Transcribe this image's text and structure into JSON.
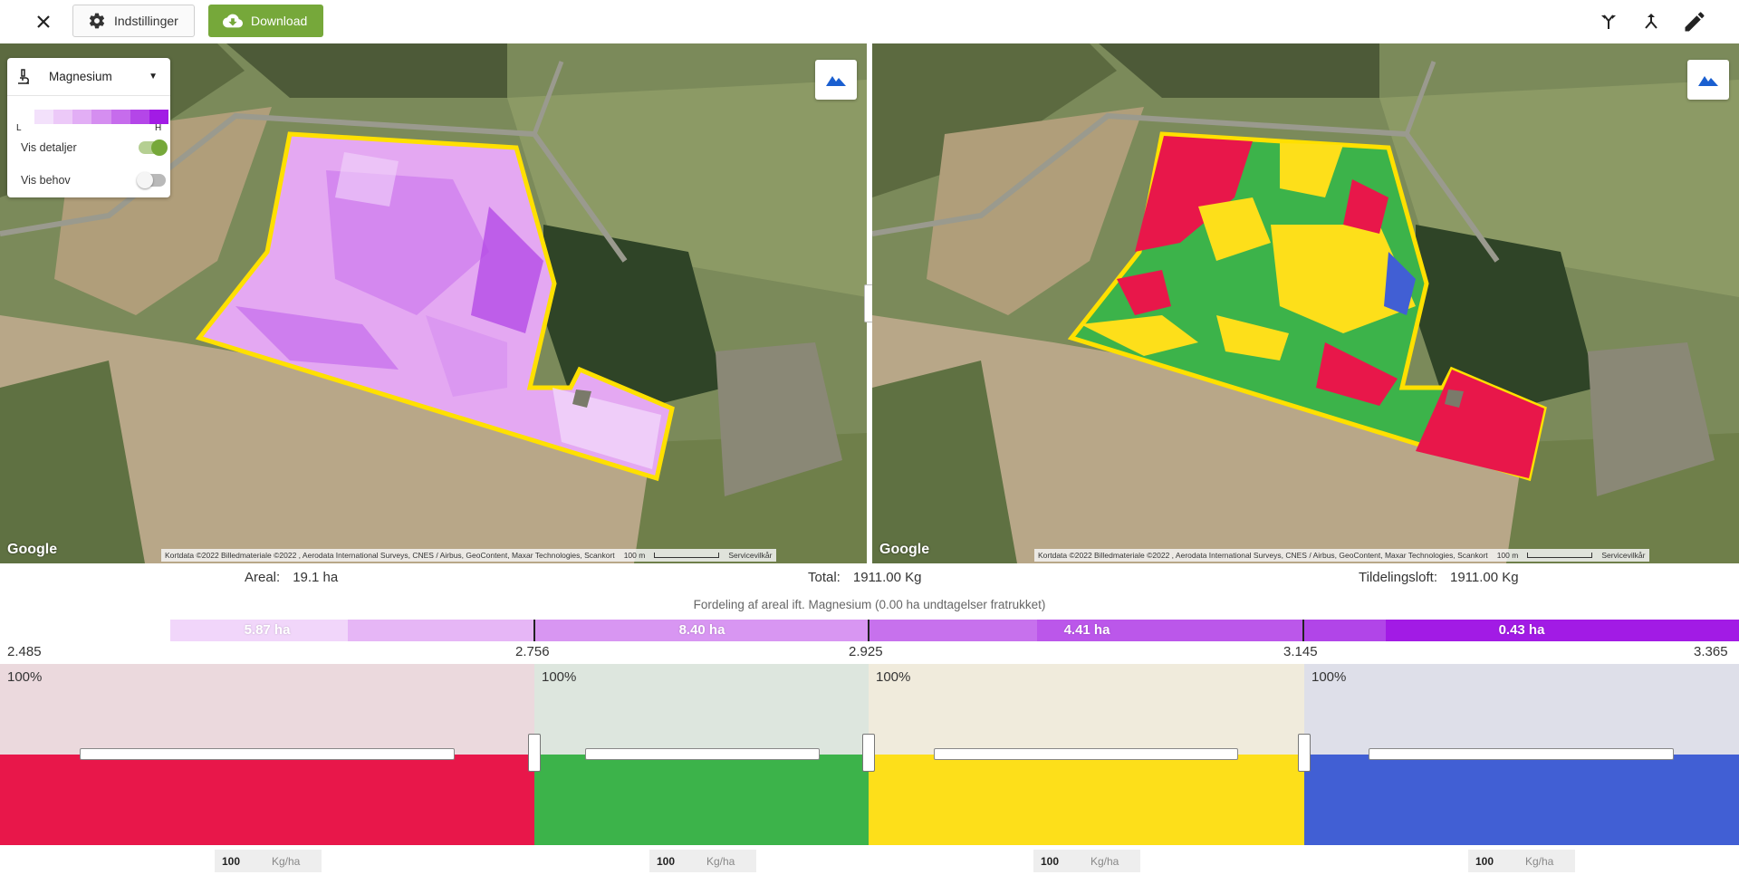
{
  "toolbar": {
    "close_icon": "close-icon",
    "settings_label": "Indstillinger",
    "settings_icon": "gear-icon",
    "download_label": "Download",
    "download_icon": "cloud-download-icon",
    "tools": [
      "split-icon",
      "merge-icon",
      "pencil-icon"
    ]
  },
  "layer_panel": {
    "layer_icon": "microscope-icon",
    "selected_layer": "Magnesium",
    "legend_low": "L",
    "legend_high": "H",
    "legend_colors": [
      "#f3e1fb",
      "#ecc9f8",
      "#e2aef5",
      "#d58ef0",
      "#c66cec",
      "#b446e8",
      "#a21be5"
    ],
    "show_details_label": "Vis detaljer",
    "show_details": true,
    "show_need_label": "Vis behov",
    "show_need": false
  },
  "map": {
    "google": "Google",
    "attribution": "Kortdata ©2022 Billedmateriale ©2022 , Aerodata International Surveys, CNES / Airbus, GeoContent, Maxar Technologies, Scankort",
    "scale": "100 m",
    "terms": "Servicevilkår"
  },
  "stats": {
    "area_label": "Areal:",
    "area_value": "19.1 ha",
    "total_label": "Total:",
    "total_value": "1911.00 Kg",
    "cap_label": "Tildelingsloft:",
    "cap_value": "1911.00 Kg"
  },
  "distribution": {
    "title": "Fordeling af areal ift. Magnesium (0.00 ha undtagelser fratrukket)",
    "zones": [
      {
        "area": "5.87 ha"
      },
      {
        "area": "8.40 ha"
      },
      {
        "area": "4.41 ha"
      },
      {
        "area": "0.43 ha"
      }
    ],
    "ticks": [
      "2.485",
      "2.756",
      "2.925",
      "3.145",
      "3.365"
    ]
  },
  "allocation": {
    "zones": [
      {
        "percent": "100%",
        "color": "#e8174a",
        "tint": "#ebd9dd",
        "rate": "100",
        "unit": "Kg/ha"
      },
      {
        "percent": "100%",
        "color": "#3cb34a",
        "tint": "#dde6de",
        "rate": "100",
        "unit": "Kg/ha"
      },
      {
        "percent": "100%",
        "color": "#fddf1a",
        "tint": "#f0ebdc",
        "rate": "100",
        "unit": "Kg/ha"
      },
      {
        "percent": "100%",
        "color": "#415fd4",
        "tint": "#dedfe9",
        "rate": "100",
        "unit": "Kg/ha"
      }
    ]
  }
}
